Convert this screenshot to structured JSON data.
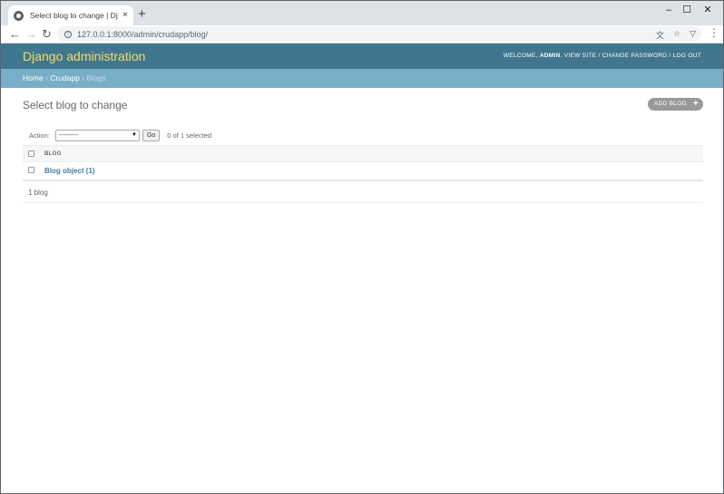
{
  "browser": {
    "tab_title": "Select blog to change | Django",
    "url": "127.0.0.1:8000/admin/crudapp/blog/",
    "tab_close": "×",
    "new_tab": "+",
    "controls": {
      "minimize": "–",
      "maximize": "☐",
      "close": "✕"
    }
  },
  "header": {
    "branding": "Django administration",
    "welcome": "Welcome,",
    "username": "Admin",
    "view_site": "View site",
    "change_password": "Change password",
    "log_out": "Log out",
    "separator": "/"
  },
  "breadcrumbs": {
    "home": "Home",
    "app": "Crudapp",
    "current": "Blogs",
    "separator": "›"
  },
  "main": {
    "title": "Select blog to change",
    "add_button": "ADD BLOG",
    "add_plus": "+"
  },
  "actions": {
    "label": "Action:",
    "selected_option": "---------",
    "go": "Go",
    "counter": "0 of 1 selected"
  },
  "table": {
    "column": "BLOG",
    "rows": [
      "Blog object (1)"
    ]
  },
  "paginator": "1 blog",
  "colors": {
    "header_bg": "#417690",
    "branding": "#f5dd5d",
    "breadcrumb_bg": "#79aec8",
    "link": "#447e9b"
  }
}
